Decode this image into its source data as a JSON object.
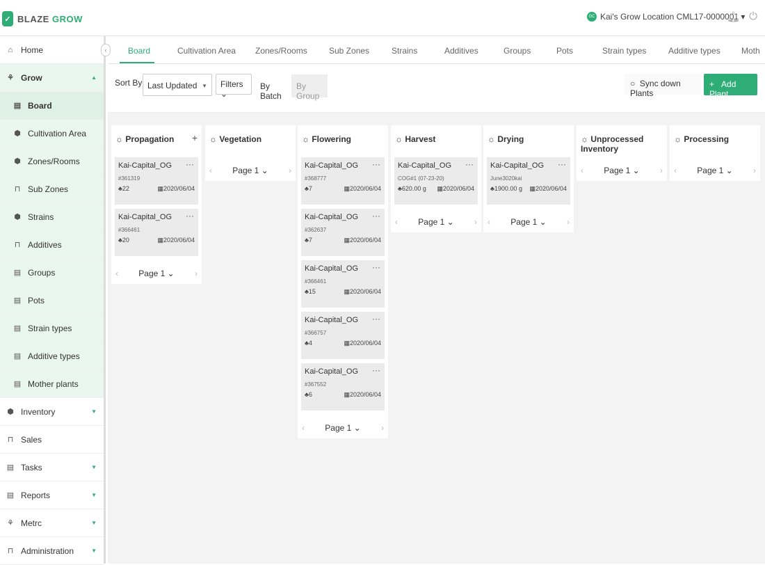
{
  "brand": {
    "name_part1": "BLAZE",
    "name_part2": "GROW"
  },
  "header": {
    "location_badge": "GC",
    "location": "Kai's Grow Location CML17-0000001 ▾"
  },
  "sidebar": {
    "items": [
      {
        "label": "Home",
        "icon": "home-icon"
      },
      {
        "label": "Grow",
        "icon": "grow-icon"
      },
      {
        "label": "Board",
        "icon": "clipboard-icon"
      },
      {
        "label": "Cultivation Area",
        "icon": "shield-icon"
      },
      {
        "label": "Zones/Rooms",
        "icon": "shield-icon"
      },
      {
        "label": "Sub Zones",
        "icon": "cart-icon"
      },
      {
        "label": "Strains",
        "icon": "shield-icon"
      },
      {
        "label": "Additives",
        "icon": "cart-icon"
      },
      {
        "label": "Groups",
        "icon": "clipboard-icon"
      },
      {
        "label": "Pots",
        "icon": "clipboard-icon"
      },
      {
        "label": "Strain types",
        "icon": "clipboard-icon"
      },
      {
        "label": "Additive types",
        "icon": "clipboard-icon"
      },
      {
        "label": "Mother plants",
        "icon": "clipboard-icon"
      },
      {
        "label": "Inventory",
        "icon": "shield-icon"
      },
      {
        "label": "Sales",
        "icon": "cart-icon"
      },
      {
        "label": "Tasks",
        "icon": "clipboard-icon"
      },
      {
        "label": "Reports",
        "icon": "clipboard-icon"
      },
      {
        "label": "Metrc",
        "icon": "grow-icon"
      },
      {
        "label": "Administration",
        "icon": "cart-icon"
      }
    ]
  },
  "tabs": [
    "Board",
    "Cultivation Area",
    "Zones/Rooms",
    "Sub Zones",
    "Strains",
    "Additives",
    "Groups",
    "Pots",
    "Strain types",
    "Additive types",
    "Moth"
  ],
  "toolbar": {
    "sort_label": "Sort By",
    "sort_value": "Last Updated",
    "filters_label": "Filters",
    "by_batch": "By Batch",
    "by_group": "By Group",
    "sync_label": "Sync down Plants",
    "add_label": "Add Plant"
  },
  "page_label": "Page 1",
  "columns": [
    {
      "title": "Propagation",
      "has_add": true,
      "cards": [
        {
          "name": "Kai-Capital_OG",
          "id": "#361319",
          "count": "22",
          "date": "2020/06/04"
        },
        {
          "name": "Kai-Capital_OG",
          "id": "#366461",
          "count": "20",
          "date": "2020/06/04"
        }
      ]
    },
    {
      "title": "Vegetation",
      "has_add": false,
      "cards": []
    },
    {
      "title": "Flowering",
      "has_add": false,
      "cards": [
        {
          "name": "Kai-Capital_OG",
          "id": "#368777",
          "count": "7",
          "date": "2020/06/04"
        },
        {
          "name": "Kai-Capital_OG",
          "id": "#362637",
          "count": "7",
          "date": "2020/06/04"
        },
        {
          "name": "Kai-Capital_OG",
          "id": "#366461",
          "count": "15",
          "date": "2020/06/04"
        },
        {
          "name": "Kai-Capital_OG",
          "id": "#366757",
          "count": "4",
          "date": "2020/06/04"
        },
        {
          "name": "Kai-Capital_OG",
          "id": "#367552",
          "count": "6",
          "date": "2020/06/04"
        }
      ]
    },
    {
      "title": "Harvest",
      "has_add": false,
      "cards": [
        {
          "name": "Kai-Capital_OG",
          "id": "COG#1 (07-23-20)",
          "count": "620.00 g",
          "date": "2020/06/04"
        }
      ]
    },
    {
      "title": "Drying",
      "has_add": false,
      "cards": [
        {
          "name": "Kai-Capital_OG",
          "id": "June3020kai",
          "count": "1900.00 g",
          "date": "2020/06/04"
        }
      ]
    },
    {
      "title": "Unprocessed Inventory",
      "has_add": false,
      "cards": []
    },
    {
      "title": "Processing",
      "has_add": false,
      "cards": []
    }
  ]
}
